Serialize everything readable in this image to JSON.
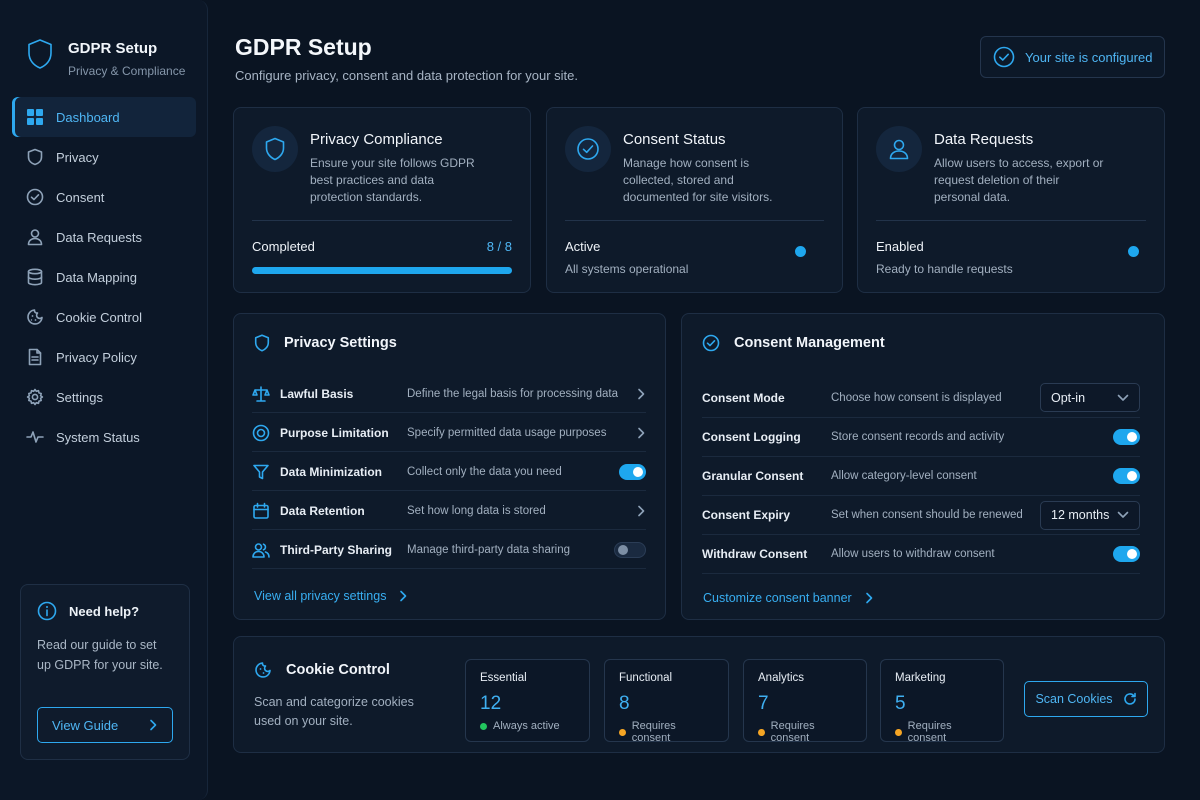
{
  "brand": {
    "title": "GDPR Setup",
    "subtitle": "Privacy & Compliance"
  },
  "sidebar": {
    "items": [
      {
        "label": "Dashboard",
        "icon": "grid-icon",
        "active": true
      },
      {
        "label": "Privacy",
        "icon": "shield-icon"
      },
      {
        "label": "Consent",
        "icon": "check-circle-icon"
      },
      {
        "label": "Data Requests",
        "icon": "user-icon"
      },
      {
        "label": "Data Mapping",
        "icon": "database-icon"
      },
      {
        "label": "Cookie Control",
        "icon": "cookie-icon"
      },
      {
        "label": "Privacy Policy",
        "icon": "document-icon"
      },
      {
        "label": "Settings",
        "icon": "gear-icon"
      },
      {
        "label": "System Status",
        "icon": "pulse-icon"
      }
    ],
    "help": {
      "title": "Need help?",
      "text": "Read our guide to set up GDPR for your site.",
      "button": "View Guide"
    }
  },
  "header": {
    "title": "GDPR Setup",
    "subtitle": "Configure privacy, consent and data protection for your site.",
    "status": "Your site is configured"
  },
  "cards": {
    "privacy": {
      "title": "Privacy Compliance",
      "desc": "Ensure your site follows GDPR best practices and data protection standards.",
      "status": "Completed",
      "count": "8 / 8",
      "progress": 1.0
    },
    "consent": {
      "title": "Consent Status",
      "desc": "Manage how consent is collected, stored and documented for site visitors.",
      "status": "Active",
      "note": "All systems operational"
    },
    "requests": {
      "title": "Data Requests",
      "desc": "Allow users to access, export or request deletion of their personal data.",
      "status": "Enabled",
      "note": "Ready to handle requests"
    }
  },
  "privacy_settings": {
    "title": "Privacy Settings",
    "rows": [
      {
        "name": "Lawful Basis",
        "desc": "Define the legal basis for processing data",
        "control": "chevron",
        "icon": "scale-icon"
      },
      {
        "name": "Purpose Limitation",
        "desc": "Specify permitted data usage purposes",
        "control": "chevron",
        "icon": "target-icon"
      },
      {
        "name": "Data Minimization",
        "desc": "Collect only the data you need",
        "control": "toggle-on",
        "icon": "filter-icon"
      },
      {
        "name": "Data Retention",
        "desc": "Set how long data is stored",
        "control": "chevron",
        "icon": "calendar-icon"
      },
      {
        "name": "Third-Party Sharing",
        "desc": "Manage third-party data sharing",
        "control": "toggle-off",
        "icon": "users-icon"
      }
    ],
    "link": "View all privacy settings"
  },
  "consent_management": {
    "title": "Consent Management",
    "rows": [
      {
        "name": "Consent Mode",
        "desc": "Choose how consent is displayed",
        "control": "select",
        "value": "Opt-in"
      },
      {
        "name": "Consent Logging",
        "desc": "Store consent records and activity",
        "control": "toggle-on"
      },
      {
        "name": "Granular Consent",
        "desc": "Allow category-level consent",
        "control": "toggle-on"
      },
      {
        "name": "Consent Expiry",
        "desc": "Set when consent should be renewed",
        "control": "select",
        "value": "12 months"
      },
      {
        "name": "Withdraw Consent",
        "desc": "Allow users to withdraw consent",
        "control": "toggle-on"
      }
    ],
    "link": "Customize consent banner"
  },
  "cookie_control": {
    "title": "Cookie Control",
    "desc": "Scan and categorize cookies used on your site.",
    "categories": [
      {
        "name": "Essential",
        "count": "12",
        "note": "Always active",
        "color": "#22c55e"
      },
      {
        "name": "Functional",
        "count": "8",
        "note": "Requires consent",
        "color": "#f5a524"
      },
      {
        "name": "Analytics",
        "count": "7",
        "note": "Requires consent",
        "color": "#f5a524"
      },
      {
        "name": "Marketing",
        "count": "5",
        "note": "Requires consent",
        "color": "#f5a524"
      }
    ],
    "scan_button": "Scan Cookies"
  },
  "colors": {
    "accent": "#1ea7ee",
    "background": "#0a1422",
    "card": "#0e1a2a"
  }
}
